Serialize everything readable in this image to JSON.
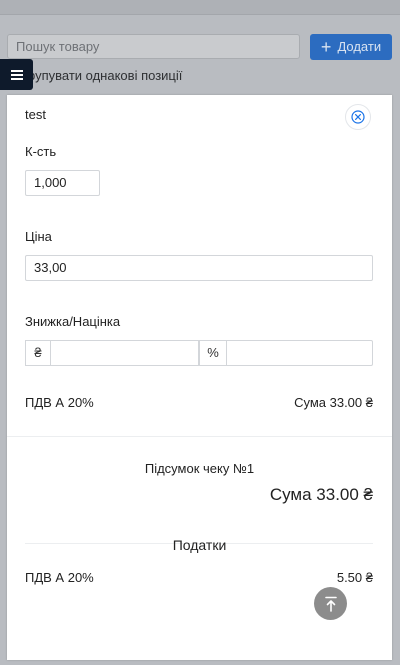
{
  "background": {
    "search_placeholder": "Пошук товару",
    "add_button_label": "Додати",
    "group_label": "рупувати однакові позиції"
  },
  "modal": {
    "title": "test",
    "quantity": {
      "label": "К-сть",
      "value": "1,000"
    },
    "price": {
      "label": "Ціна",
      "value": "33,00"
    },
    "discount": {
      "label": "Знижка/Націнка",
      "currency_symbol": "₴",
      "percent_symbol": "%",
      "currency_value": "",
      "percent_value": ""
    },
    "item_vat": {
      "label": "ПДВ А 20%",
      "sum": "Сума 33.00 ₴"
    },
    "receipt": {
      "title": "Підсумок чеку №1",
      "total": "Сума 33.00 ₴",
      "taxes_title": "Податки",
      "tax_label": "ПДВ А 20%",
      "tax_value": "5.50 ₴"
    }
  },
  "colors": {
    "primary": "#2c6cc0",
    "menu_button": "#0e1a2b",
    "close_icon": "#1a73e8",
    "scroll_button": "#8c8c8c"
  },
  "icons": {
    "menu": "hamburger-icon",
    "close": "close-circle-icon",
    "scroll_top": "arrow-up-to-line-icon",
    "add": "plus-icon"
  }
}
